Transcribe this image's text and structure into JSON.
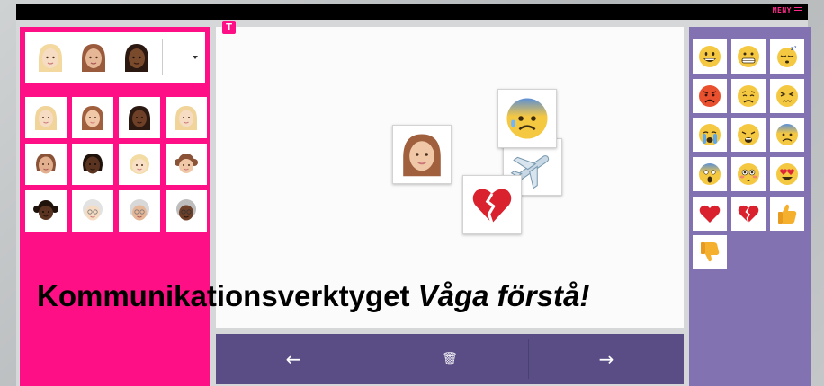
{
  "header": {
    "menu_label": "MENY"
  },
  "workspace": {
    "badge_label": "T"
  },
  "nav": {
    "back_label": "←",
    "trash_label": "🗑",
    "forward_label": "→"
  },
  "caption": {
    "main": "Kommunikationsverktyget ",
    "italic": "Våga förstå!"
  },
  "colors": {
    "pink": "#ff0f86",
    "purple_panel": "#8272b2",
    "nav_bar": "#5a4d86",
    "black_bar": "#000000"
  },
  "left_panel": {
    "skin_selector": [
      "woman-light-icon",
      "woman-medium-icon",
      "woman-dark-icon"
    ],
    "faces": [
      "woman-blonde-icon",
      "woman-brown-icon",
      "woman-dark-icon",
      "woman-blonde-icon",
      "woman-medium-icon",
      "woman-dark-icon",
      "girl-blonde-icon",
      "girl-brown-icon",
      "girl-dark-icon",
      "old-woman-icon",
      "old-woman-icon",
      "old-woman-dark-icon"
    ]
  },
  "canvas_cards": [
    "woman-brown-icon",
    "anxious-face-icon",
    "airplane-icon",
    "broken-heart-icon"
  ],
  "right_panel": {
    "emojis": [
      "grinning-face-icon",
      "grimacing-face-icon",
      "sleeping-face-icon",
      "angry-face-icon",
      "confounded-face-icon",
      "persevering-face-icon",
      "crying-face-icon",
      "weary-face-icon",
      "anxious-face-icon",
      "screaming-face-icon",
      "flushed-face-icon",
      "heart-eyes-face-icon",
      "red-heart-icon",
      "broken-heart-icon",
      "thumbs-up-icon",
      "thumbs-down-icon"
    ]
  }
}
